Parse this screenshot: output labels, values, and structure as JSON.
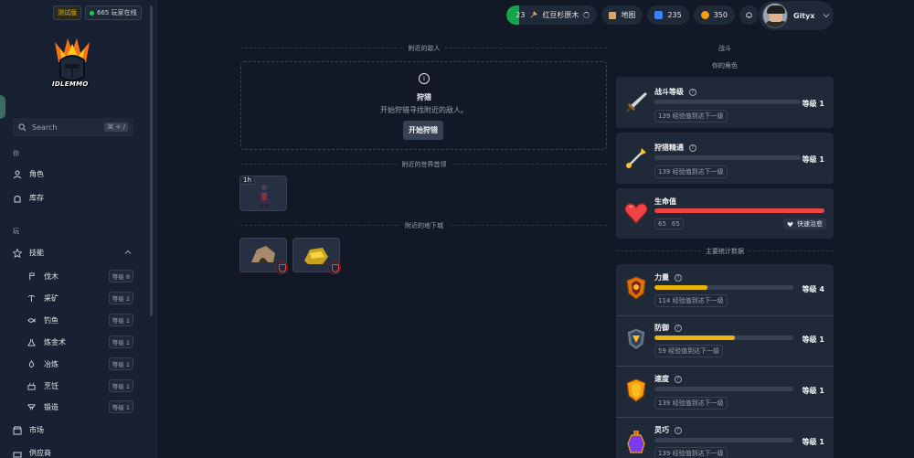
{
  "sidebar": {
    "badge_test": "测试版",
    "online": "665 玩家在线",
    "logo_text": "IDLEMMO",
    "search_placeholder": "Search",
    "search_kbd": "⌘ + /",
    "section_you": "你",
    "nav_character": "角色",
    "nav_inventory": "库存",
    "section_play": "玩",
    "nav_skills": "技能",
    "skills": [
      {
        "label": "伐木",
        "level": "等级 8",
        "icon": "axe-icon"
      },
      {
        "label": "采矿",
        "level": "等级 2",
        "icon": "pickaxe-icon"
      },
      {
        "label": "钓鱼",
        "level": "等级 1",
        "icon": "fish-icon"
      },
      {
        "label": "炼金术",
        "level": "等级 1",
        "icon": "flask-icon"
      },
      {
        "label": "冶炼",
        "level": "等级 1",
        "icon": "flame-icon"
      },
      {
        "label": "烹饪",
        "level": "等级 1",
        "icon": "pot-icon"
      },
      {
        "label": "锻造",
        "level": "等级 1",
        "icon": "anvil-icon"
      }
    ],
    "nav_market": "市场",
    "nav_vendor": "供应商"
  },
  "topbar": {
    "task_count": "23",
    "task_name": "红豆杉原木",
    "map_label": "地图",
    "gems": "235",
    "gold": "350",
    "username": "Gityx"
  },
  "main": {
    "nearby_enemies": "附近的敌人",
    "hunt_title": "狩猎",
    "hunt_desc": "开始狩猎寻找附近的敌人。",
    "hunt_button": "开始狩猎",
    "nearby_bosses": "附近的世界首领",
    "boss_timer": "1h",
    "nearby_dungeons": "附近的地下城"
  },
  "right": {
    "combat_title": "战斗",
    "your_character": "你的角色",
    "combat_level_name": "战斗等级",
    "combat_level": "等级 1",
    "combat_xp": "139 经验值到达下一级",
    "hunting_name": "狩猎精通",
    "hunting_level": "等级 1",
    "hunting_xp": "139 经验值到达下一级",
    "health_name": "生命值",
    "health_value": "65",
    "health_max": "65",
    "health_fill": 1.0,
    "quick_heal": "快速治愈",
    "main_stats": "主要统计数据",
    "stats": [
      {
        "name": "力量",
        "level": "等级 4",
        "xp": "114 经验值到达下一级",
        "fill": 0.38,
        "color": "#eab308"
      },
      {
        "name": "防御",
        "level": "等级 1",
        "xp": "59 经验值到达下一级",
        "fill": 0.58,
        "color": "#eab308"
      },
      {
        "name": "速度",
        "level": "等级 1",
        "xp": "139 经验值到达下一级",
        "fill": 0.0,
        "color": "#eab308"
      },
      {
        "name": "灵巧",
        "level": "等级 1",
        "xp": "139 经验值到达下一级",
        "fill": 0.0,
        "color": "#eab308"
      }
    ]
  }
}
